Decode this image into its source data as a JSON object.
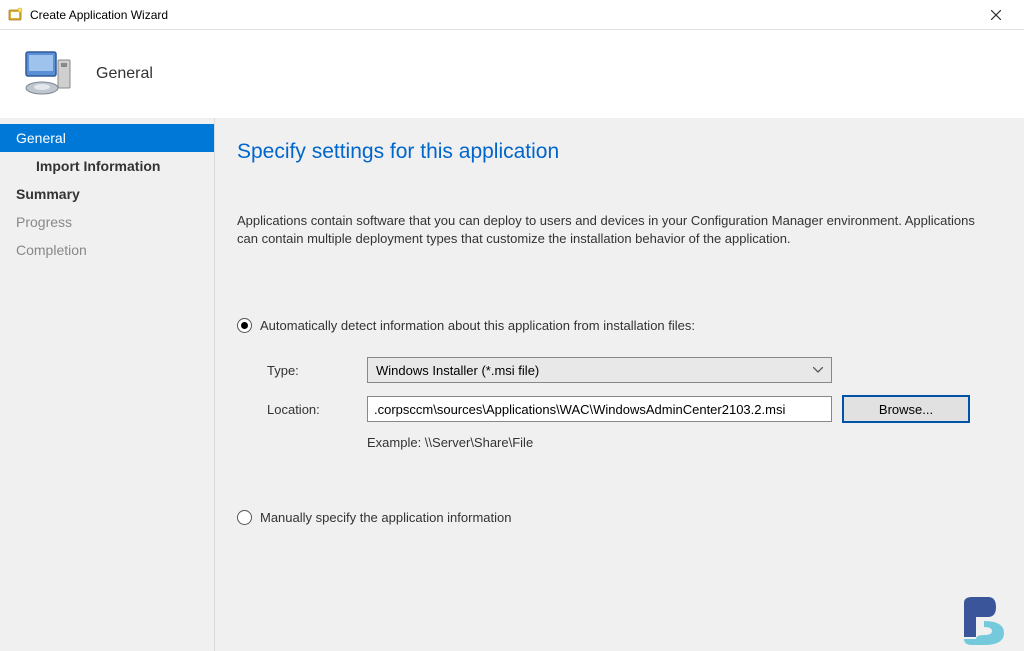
{
  "window": {
    "title": "Create Application Wizard"
  },
  "header": {
    "label": "General"
  },
  "sidebar": {
    "items": [
      {
        "label": "General",
        "selected": true
      },
      {
        "label": "Import Information",
        "sub": true
      },
      {
        "label": "Summary",
        "bold": true
      },
      {
        "label": "Progress",
        "muted": true
      },
      {
        "label": "Completion",
        "muted": true
      }
    ]
  },
  "content": {
    "heading": "Specify settings for this application",
    "description": "Applications contain software that you can deploy to users and devices in your Configuration Manager environment. Applications can contain multiple deployment types that customize the installation behavior of the application.",
    "radio_auto_label": "Automatically detect information about this application from installation files:",
    "radio_manual_label": "Manually specify the application information",
    "type_label": "Type:",
    "type_value": "Windows Installer (*.msi file)",
    "location_label": "Location:",
    "location_value": ".corpsccm\\sources\\Applications\\WAC\\WindowsAdminCenter2103.2.msi",
    "example_text": "Example: \\\\Server\\Share\\File",
    "browse_label": "Browse..."
  }
}
